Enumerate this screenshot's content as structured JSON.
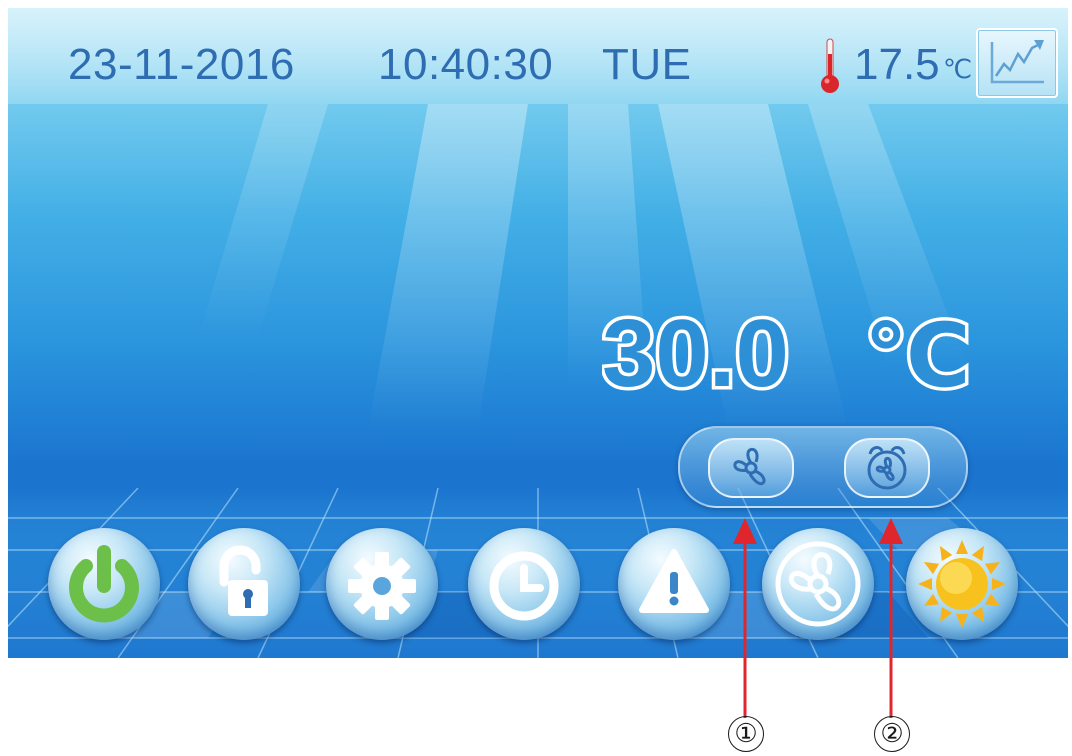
{
  "status_bar": {
    "date": "23-11-2016",
    "time": "10:40:30",
    "weekday": "TUE",
    "room_temperature": "17.5",
    "room_temperature_unit": "℃"
  },
  "setpoint": {
    "value": "30.0",
    "unit": "℃"
  },
  "status_indicators": {
    "fan": "fan-running-icon",
    "timer": "alarm-clock-icon"
  },
  "bottom_menu": [
    {
      "icon": "power-icon",
      "color": "#6cc04a"
    },
    {
      "icon": "unlock-icon"
    },
    {
      "icon": "gear-icon"
    },
    {
      "icon": "clock-icon"
    },
    {
      "icon": "warning-icon"
    },
    {
      "icon": "fan-icon"
    },
    {
      "icon": "sun-icon",
      "color": "#f6b21a"
    }
  ],
  "callouts": {
    "label_1": "①",
    "label_2": "②"
  },
  "colors": {
    "text_blue": "#2f6db3",
    "arrow_red": "#e0262d"
  }
}
